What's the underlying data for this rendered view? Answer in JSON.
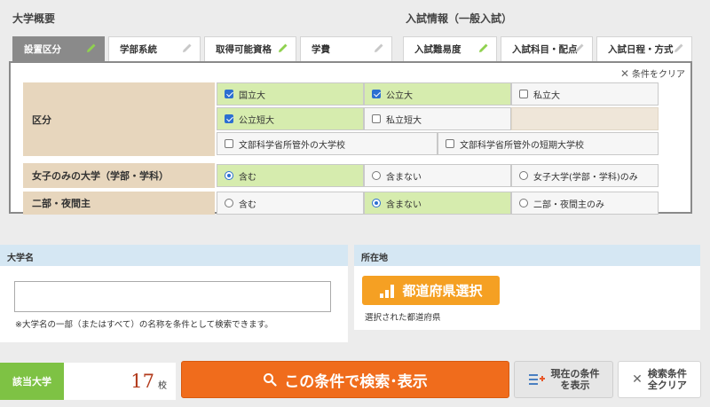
{
  "sections": {
    "overview": "大学概要",
    "exam": "入試情報（一般入試）"
  },
  "tabs": [
    {
      "label": "設置区分",
      "icon": "pencil-icon",
      "active": true
    },
    {
      "label": "学部系統",
      "icon": "pencil-icon"
    },
    {
      "label": "取得可能資格",
      "icon": "pencil-icon"
    },
    {
      "label": "学費",
      "icon": "pencil-icon"
    },
    {
      "label": "入試難易度",
      "icon": "pencil-icon"
    },
    {
      "label": "入試科目・配点",
      "icon": "pencil-icon"
    },
    {
      "label": "入試日程・方式",
      "icon": "pencil-icon"
    }
  ],
  "panel": {
    "clear_label": "条件をクリア",
    "kubun": {
      "label": "区分",
      "options": [
        {
          "label": "国立大",
          "checked": true
        },
        {
          "label": "公立大",
          "checked": true
        },
        {
          "label": "私立大",
          "checked": false
        },
        {
          "label": "公立短大",
          "checked": true
        },
        {
          "label": "私立短大",
          "checked": false
        },
        {
          "label": "文部科学省所管外の大学校",
          "checked": false
        },
        {
          "label": "文部科学省所管外の短期大学校",
          "checked": false
        }
      ]
    },
    "women": {
      "label": "女子のみの大学（学部・学科）",
      "options": [
        {
          "label": "含む",
          "checked": true
        },
        {
          "label": "含まない",
          "checked": false
        },
        {
          "label": "女子大学(学部・学科)のみ",
          "checked": false
        }
      ]
    },
    "night": {
      "label": "二部・夜間主",
      "options": [
        {
          "label": "含む",
          "checked": false
        },
        {
          "label": "含まない",
          "checked": true
        },
        {
          "label": "二部・夜間主のみ",
          "checked": false
        }
      ]
    }
  },
  "name_box": {
    "header": "大学名",
    "value": "",
    "placeholder": "",
    "note": "※大学名の一部（またはすべて）の名称を条件として検索できます。"
  },
  "location_box": {
    "header": "所在地",
    "button_label": "都道府県選択",
    "selected_label": "選択された都道府県"
  },
  "bottom": {
    "count_label": "該当大学",
    "count_value": "17",
    "count_unit": "校",
    "search_label": "この条件で検索･表示",
    "show_cond_line1": "現在の条件",
    "show_cond_line2": "を表示",
    "reset_line1": "検索条件",
    "reset_line2": "全クリア"
  },
  "colors": {
    "active_tab": "#8a8a8a",
    "checked_cell": "#d6ecae",
    "label_cell": "#e7d6bd",
    "search_button": "#f06c1c",
    "prefecture_button": "#f5a023",
    "count_label": "#7ec244",
    "box_header": "#d5e7f3"
  }
}
